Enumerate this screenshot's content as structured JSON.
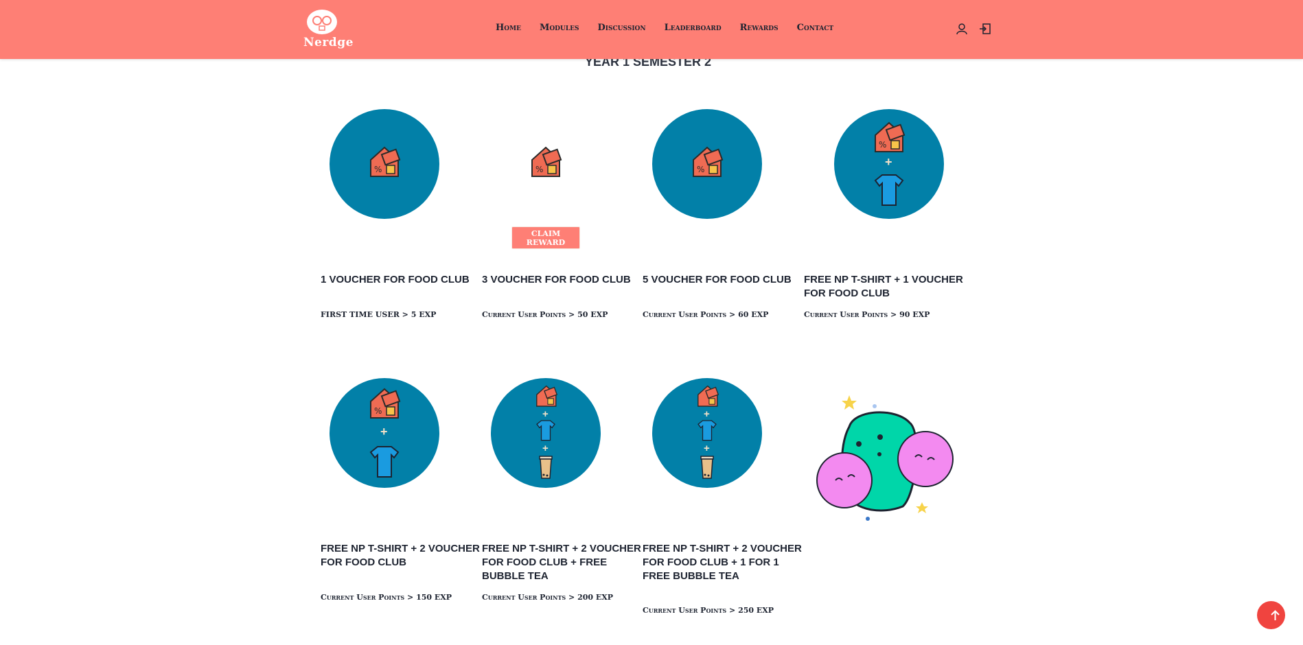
{
  "nav": {
    "logo_text": "Nerdge",
    "items": [
      "Home",
      "Modules",
      "Discussion",
      "Leaderboard",
      "Rewards",
      "Contact"
    ],
    "icons": [
      "user-icon",
      "sign-out-icon"
    ]
  },
  "page": {
    "title": "YEAR 1 SEMESTER 2"
  },
  "rewards": [
    {
      "title": "1 VOUCHER FOR FOOD CLUB",
      "requirement": "FIRST TIME USER > 5 EXP",
      "items": [
        "voucher"
      ]
    },
    {
      "title": "3 VOUCHER FOR FOOD CLUB",
      "requirement": "Current User Points > 50 EXP",
      "items": [
        "voucher"
      ],
      "claim_label": "CLAIM REWARD"
    },
    {
      "title": "5 VOUCHER FOR FOOD CLUB",
      "requirement": "Current User Points > 60 EXP",
      "items": [
        "voucher"
      ]
    },
    {
      "title": "FREE NP T-SHIRT + 1 VOUCHER FOR FOOD CLUB",
      "requirement": "Current User Points > 90 EXP",
      "items": [
        "voucher",
        "tshirt"
      ]
    },
    {
      "title": "FREE NP T-SHIRT + 2 VOUCHER FOR FOOD CLUB",
      "requirement": "Current User Points > 150 EXP",
      "items": [
        "voucher",
        "tshirt"
      ]
    },
    {
      "title": "FREE NP T-SHIRT + 2 VOUCHER FOR FOOD CLUB + FREE BUBBLE TEA",
      "requirement": "Current User Points > 200 EXP",
      "items": [
        "voucher",
        "tshirt",
        "bubble-tea"
      ]
    },
    {
      "title": "FREE NP T-SHIRT + 2 VOUCHER FOR FOOD CLUB + 1 FOR 1 FREE BUBBLE TEA",
      "requirement": "Current User Points > 250 EXP",
      "items": [
        "voucher",
        "tshirt",
        "bubble-tea"
      ]
    }
  ],
  "colors": {
    "nav_bg": "#fe7f75",
    "circle": "#0280a8",
    "back_to_top": "#f0443f"
  },
  "back_to_top_icon": "arrow-up-icon"
}
